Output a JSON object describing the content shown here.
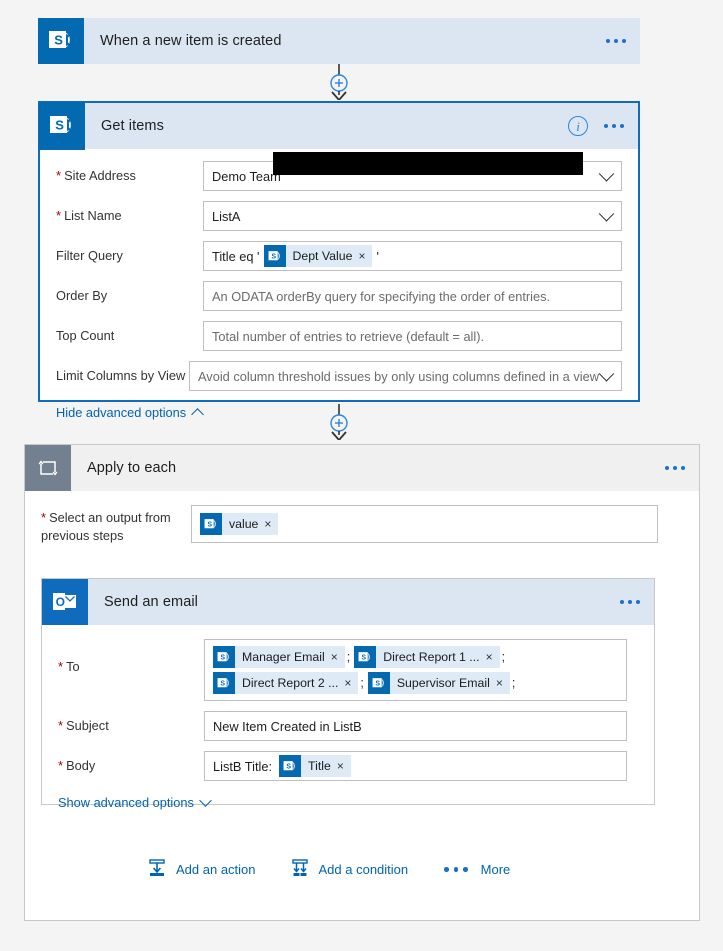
{
  "flow": {
    "trigger": {
      "title": "When a new item is created",
      "icon": "sharepoint-icon",
      "menu": "more-options"
    },
    "get_items": {
      "title": "Get items",
      "icon": "sharepoint-icon",
      "selected": true,
      "accent": "#0f6cbd",
      "fields": [
        {
          "label": "Site Address",
          "required": true,
          "value": "Demo Team",
          "redacted": true,
          "control": "dropdown"
        },
        {
          "label": "List Name",
          "required": true,
          "value": "ListA",
          "control": "dropdown"
        },
        {
          "label": "Filter Query",
          "required": false,
          "control": "tokens",
          "prefix": "Title eq '",
          "suffix": "'",
          "tokens": [
            {
              "label": "Dept Value",
              "icon": "sharepoint-icon",
              "remove": "×"
            }
          ]
        },
        {
          "label": "Order By",
          "required": false,
          "placeholder": "An ODATA orderBy query for specifying the order of entries.",
          "control": "text"
        },
        {
          "label": "Top Count",
          "required": false,
          "placeholder": "Total number of entries to retrieve (default = all).",
          "control": "text"
        },
        {
          "label": "Limit Columns by View",
          "required": false,
          "placeholder": "Avoid column threshold issues by only using columns defined in a view",
          "control": "dropdown"
        }
      ],
      "advanced_link": "Hide advanced options",
      "advanced_caret": "up"
    },
    "apply_to_each": {
      "title": "Apply to each",
      "icon": "loop-icon",
      "field": {
        "label": "Select an output from previous steps",
        "required": true,
        "tokens": [
          {
            "label": "value",
            "icon": "sharepoint-icon",
            "remove": "×"
          }
        ]
      }
    },
    "send_email": {
      "title": "Send an email",
      "icon": "outlook-icon",
      "to": {
        "label": "To",
        "required": true,
        "tokens": [
          {
            "label": "Manager Email",
            "icon": "sharepoint-icon",
            "remove": "×",
            "sep": ";"
          },
          {
            "label": "Direct Report 1 ...",
            "icon": "sharepoint-icon",
            "remove": "×",
            "sep": ";"
          },
          {
            "label": "Direct Report 2 ...",
            "icon": "sharepoint-icon",
            "remove": "×",
            "sep": ";"
          },
          {
            "label": "Supervisor Email",
            "icon": "sharepoint-icon",
            "remove": "×",
            "sep": ";"
          }
        ]
      },
      "subject": {
        "label": "Subject",
        "required": true,
        "value": "New Item Created in ListB"
      },
      "body": {
        "label": "Body",
        "required": true,
        "prefix": "ListB Title:",
        "tokens": [
          {
            "label": "Title",
            "icon": "sharepoint-icon",
            "remove": "×"
          }
        ]
      },
      "advanced_link": "Show advanced options",
      "advanced_caret": "down"
    },
    "actions": [
      {
        "label": "Add an action",
        "icon": "add-action-icon"
      },
      {
        "label": "Add a condition",
        "icon": "add-condition-icon"
      },
      {
        "label": "More",
        "icon": "more-dots-icon"
      }
    ],
    "connector": {
      "plus": "+",
      "arrow": "down-arrow"
    }
  }
}
